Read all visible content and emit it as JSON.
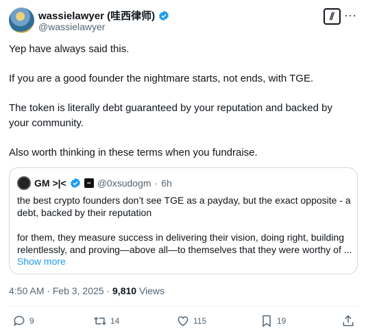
{
  "author": {
    "display_name": "wassielawyer  (哇西律师)",
    "handle": "@wassielawyer"
  },
  "header": {
    "grok_glyph": "⫽",
    "more_glyph": "···"
  },
  "tweet": {
    "paragraphs": [
      "Yep have always said this.",
      "If you are a good founder the nightmare starts, not ends, with TGE.",
      "The token is literally debt guaranteed by your reputation and backed by your community.",
      "Also worth thinking in these terms when you fundraise."
    ],
    "time": "4:50 AM",
    "separator": "·",
    "date": "Feb 3, 2025",
    "views_count": "9,810",
    "views_label": "Views"
  },
  "quote": {
    "name": "GM >|<",
    "badge_text": "▪▪",
    "handle": "@0xsudogm",
    "age": "6h",
    "paragraphs": [
      "the best crypto founders don’t see TGE as a payday, but the exact opposite - a debt, backed by their reputation",
      "for them, they measure success in delivering their vision, doing right, building relentlessly, and proving—above all—to themselves that they were worthy of ..."
    ],
    "show_more": "Show more"
  },
  "actions": {
    "replies": "9",
    "reposts": "14",
    "likes": "115",
    "bookmarks": "19"
  },
  "colors": {
    "accent": "#1d9bf0",
    "muted": "#536471",
    "text": "#0f1419",
    "border": "#cfd9de"
  }
}
